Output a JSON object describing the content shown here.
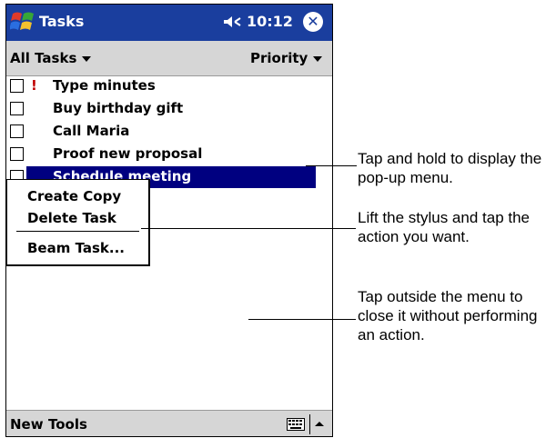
{
  "titlebar": {
    "app_title": "Tasks",
    "time": "10:12"
  },
  "filterbar": {
    "filter_label": "All Tasks",
    "sort_label": "Priority"
  },
  "tasks": [
    {
      "label": "Type minutes",
      "priority": "!"
    },
    {
      "label": "Buy birthday  gift",
      "priority": ""
    },
    {
      "label": "Call Maria",
      "priority": ""
    },
    {
      "label": "Proof new proposal",
      "priority": ""
    },
    {
      "label": "Schedule meeting",
      "priority": "",
      "selected": true
    }
  ],
  "context_menu": {
    "items": [
      "Create Copy",
      "Delete Task",
      "Beam Task..."
    ]
  },
  "bottombar": {
    "new_label": "New",
    "tools_label": "Tools"
  },
  "callouts": [
    "Tap and hold to display the pop-up menu.",
    "Lift the stylus and tap the action you want.",
    "Tap outside the menu to close it without performing an action."
  ],
  "colors": {
    "titlebar": "#1a3e9e",
    "selection": "#000080",
    "bar_gray": "#d6d6d6",
    "priority": "#c00000"
  },
  "icons": [
    "windows-start-icon",
    "volume-icon",
    "close-icon",
    "keyboard-icon",
    "sip-arrow-up-icon",
    "caret-down-icon"
  ]
}
